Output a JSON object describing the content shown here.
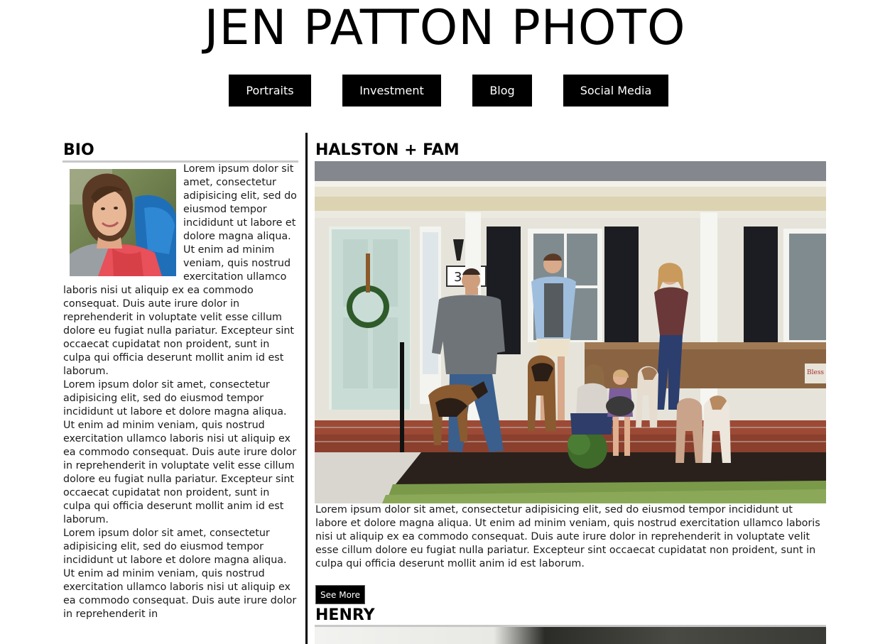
{
  "site_title": "JEN PATTON PHOTO",
  "nav": {
    "items": [
      {
        "label": "Portraits"
      },
      {
        "label": "Investment"
      },
      {
        "label": "Blog"
      },
      {
        "label": "Social Media"
      }
    ]
  },
  "bio": {
    "heading": "BIO",
    "paragraphs": [
      "Lorem ipsum dolor sit amet, consectetur adipisicing elit, sed do eiusmod tempor incididunt ut labore et dolore magna aliqua. Ut enim ad minim veniam, quis nostrud exercitation ullamco laboris nisi ut aliquip ex ea commodo consequat. Duis aute irure dolor in reprehenderit in voluptate velit esse cillum dolore eu fugiat nulla pariatur. Excepteur sint occaecat cupidatat non proident, sunt in culpa qui officia deserunt mollit anim id est laborum.",
      "Lorem ipsum dolor sit amet, consectetur adipisicing elit, sed do eiusmod tempor incididunt ut labore et dolore magna aliqua. Ut enim ad minim veniam, quis nostrud exercitation ullamco laboris nisi ut aliquip ex ea commodo consequat. Duis aute irure dolor in reprehenderit in voluptate velit esse cillum dolore eu fugiat nulla pariatur. Excepteur sint occaecat cupidatat non proident, sunt in culpa qui officia deserunt mollit anim id est laborum.",
      "Lorem ipsum dolor sit amet, consectetur adipisicing elit, sed do eiusmod tempor incididunt ut labore et dolore magna aliqua. Ut enim ad minim veniam, quis nostrud exercitation ullamco laboris nisi ut aliquip ex ea commodo consequat. Duis aute irure dolor in reprehenderit in"
    ]
  },
  "posts": [
    {
      "title": "HALSTON + FAM",
      "house_number": "30",
      "sign_text": "Bless",
      "body": "Lorem ipsum dolor sit amet, consectetur adipisicing elit, sed do eiusmod tempor incididunt ut labore et dolore magna aliqua. Ut enim ad minim veniam, quis nostrud exercitation ullamco laboris nisi ut aliquip ex ea commodo consequat. Duis aute irure dolor in reprehenderit in voluptate velit esse cillum dolore eu fugiat nulla pariatur. Excepteur sint occaecat cupidatat non proident, sunt in culpa qui officia deserunt mollit anim id est laborum.",
      "button_label": "See More"
    },
    {
      "title": "HENRY"
    }
  ],
  "colors": {
    "nav_bg": "#000000",
    "nav_text": "#ffffff",
    "rule": "#c8c8c8",
    "divider": "#000000"
  }
}
